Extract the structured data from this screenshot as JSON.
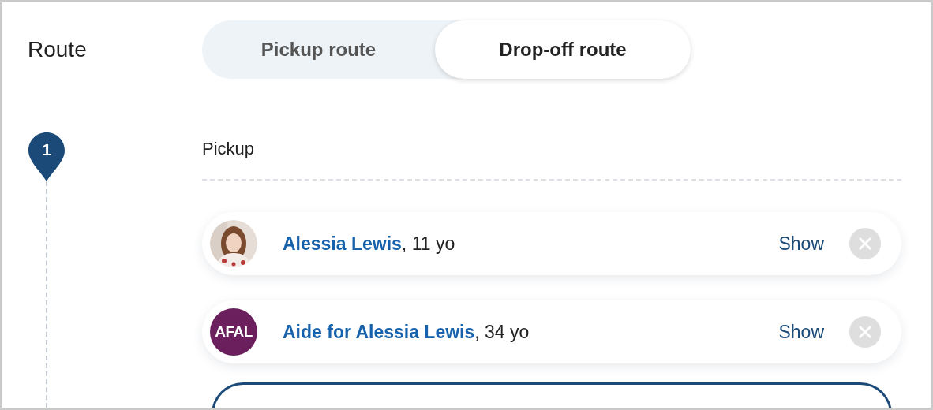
{
  "section_label": "Route",
  "route_tabs": [
    {
      "label": "Pickup route",
      "selected": false
    },
    {
      "label": "Drop-off route",
      "selected": true
    }
  ],
  "stops": [
    {
      "number": "1",
      "title": "Pickup",
      "passengers": [
        {
          "text": "**Alessia Lewis**, 11 yo",
          "action": "Show"
        },
        {
          "avatar": {
            "kind": "initials",
            "initials": "AFAL"
          },
          "text": "**Aide for Alessia Lewis**, 34 yo",
          "action": "Show"
        }
      ]
    }
  ]
}
